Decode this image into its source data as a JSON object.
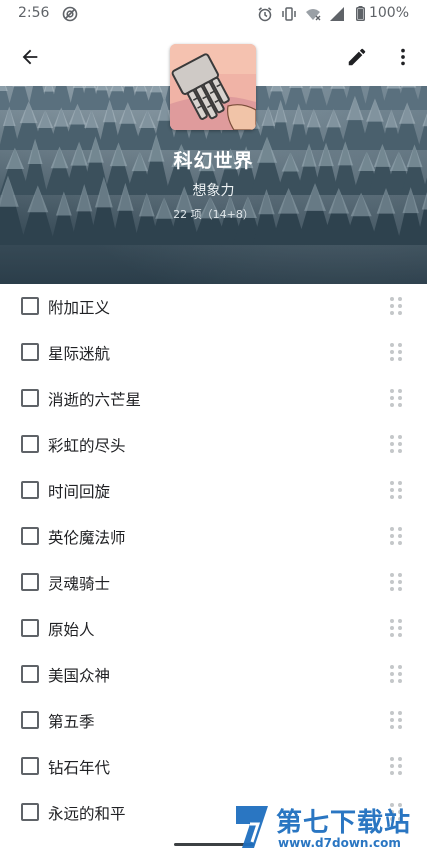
{
  "status_bar": {
    "time": "2:56",
    "battery": "100%",
    "icons": [
      "alarm-icon",
      "vibrate-icon",
      "wifi-icon",
      "signal-icon",
      "battery-icon"
    ]
  },
  "app_bar": {
    "back_icon": "arrow-back-icon",
    "edit_icon": "pencil-icon",
    "more_icon": "more-vert-icon"
  },
  "header": {
    "title": "科幻世界",
    "subtitle": "想象力",
    "meta": "22 项（14+8）"
  },
  "items": [
    {
      "label": "附加正义",
      "checked": false
    },
    {
      "label": "星际迷航",
      "checked": false
    },
    {
      "label": "消逝的六芒星",
      "checked": false
    },
    {
      "label": "彩虹的尽头",
      "checked": false
    },
    {
      "label": "时间回旋",
      "checked": false
    },
    {
      "label": "英伦魔法师",
      "checked": false
    },
    {
      "label": "灵魂骑士",
      "checked": false
    },
    {
      "label": "原始人",
      "checked": false
    },
    {
      "label": "美国众神",
      "checked": false
    },
    {
      "label": "第五季",
      "checked": false
    },
    {
      "label": "钻石年代",
      "checked": false
    },
    {
      "label": "永远的和平",
      "checked": false
    }
  ],
  "watermark": {
    "text": "第七下载站",
    "url": "www.d7down.com"
  },
  "colors": {
    "text_primary": "#202124",
    "icon": "#202124",
    "checkbox_border": "#5f6368",
    "watermark": "#1f6fbf"
  }
}
